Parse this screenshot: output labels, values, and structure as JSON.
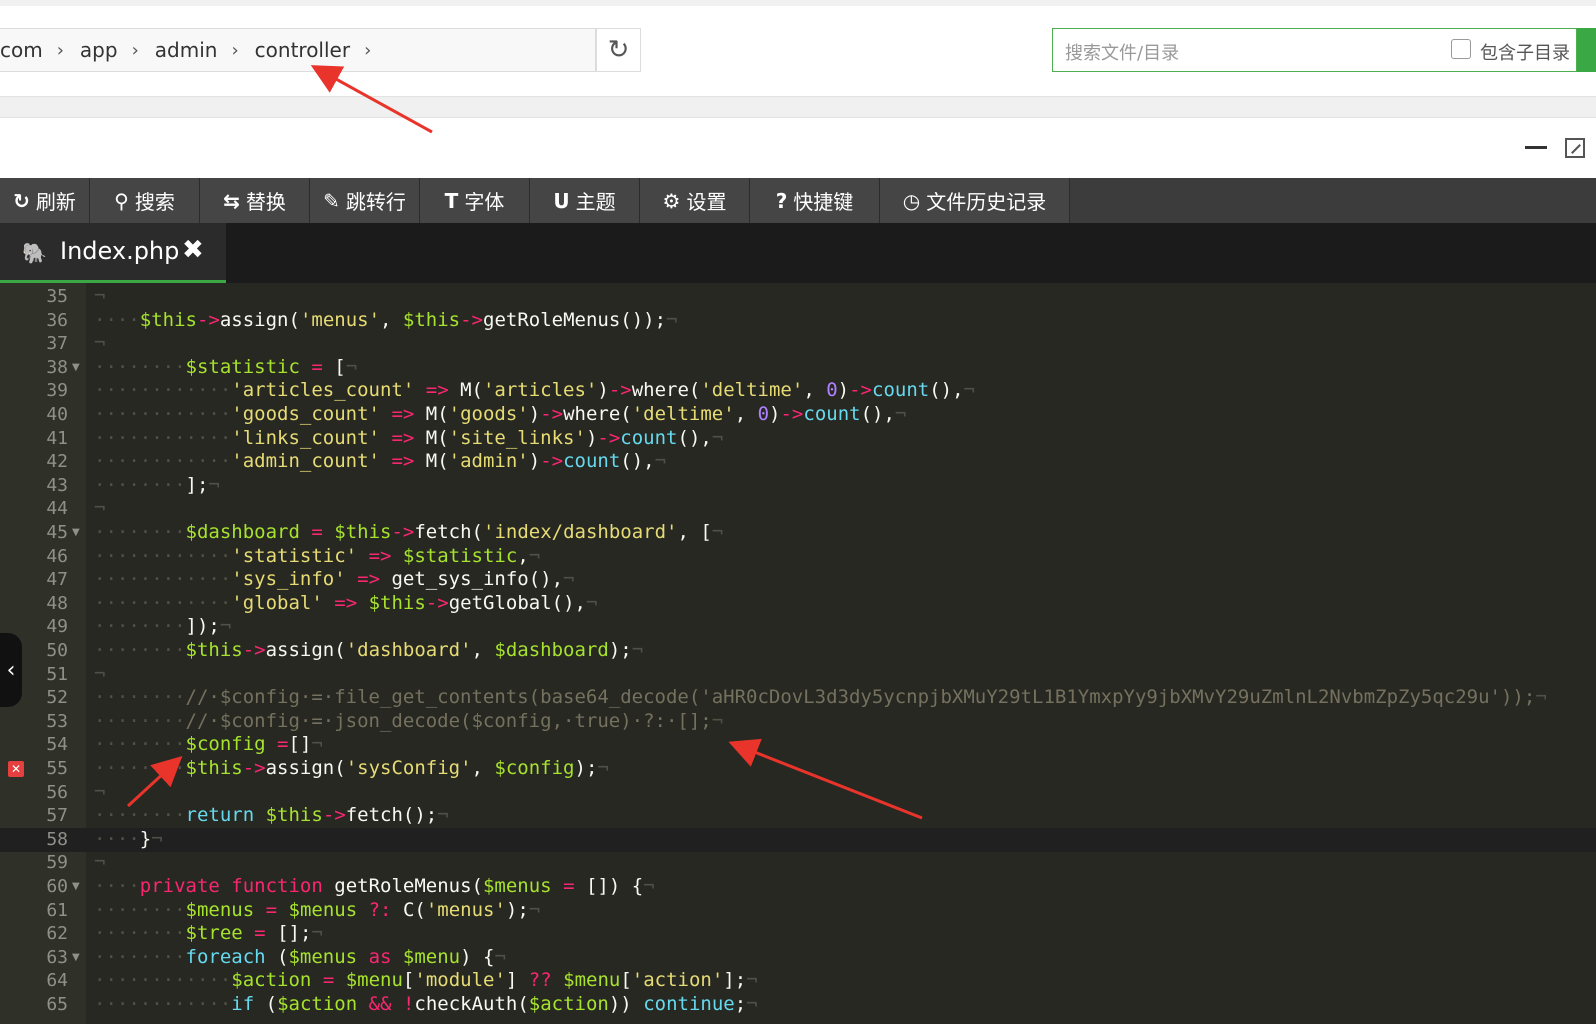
{
  "breadcrumb": {
    "segments": [
      "com",
      "app",
      "admin",
      "controller"
    ]
  },
  "search": {
    "placeholder": "搜索文件/目录",
    "include_subdir_label": "包含子目录"
  },
  "toolbar": {
    "items": [
      {
        "icon": "refresh-icon",
        "glyph": "↻",
        "label": "刷新"
      },
      {
        "icon": "search-icon",
        "glyph": "⚲",
        "label": "搜索"
      },
      {
        "icon": "replace-icon",
        "glyph": "⇆",
        "label": "替换"
      },
      {
        "icon": "pin-icon",
        "glyph": "✎",
        "label": "跳转行"
      },
      {
        "icon": "font-icon",
        "glyph": "T",
        "label": "字体"
      },
      {
        "icon": "magnet-icon",
        "glyph": "U",
        "label": "主题"
      },
      {
        "icon": "gear-icon",
        "glyph": "⚙",
        "label": "设置"
      },
      {
        "icon": "help-icon",
        "glyph": "?",
        "label": "快捷键"
      },
      {
        "icon": "clock-icon",
        "glyph": "◷",
        "label": "文件历史记录"
      }
    ]
  },
  "tab": {
    "filename": "Index.php",
    "close": "✖"
  },
  "code_lines": [
    {
      "n": "35",
      "fold": false,
      "html": "<span class=\"inv\">¬</span>"
    },
    {
      "n": "36",
      "fold": false,
      "html": "<span class=\"inv\">····</span><span class=\"vr\">$this</span><span class=\"ky\">-&gt;</span>assign(<span class=\"st\">'menus'</span>, <span class=\"vr\">$this</span><span class=\"ky\">-&gt;</span>getRoleMenus());<span class=\"inv\">¬</span>"
    },
    {
      "n": "37",
      "fold": false,
      "html": "<span class=\"inv\">¬</span>"
    },
    {
      "n": "38",
      "fold": true,
      "html": "<span class=\"inv\">········</span><span class=\"vr\">$statistic</span> <span class=\"ky\">=</span> [<span class=\"inv\">¬</span>"
    },
    {
      "n": "39",
      "fold": false,
      "html": "<span class=\"inv\">············</span><span class=\"st\">'articles_count'</span> <span class=\"ky\">=&gt;</span> M(<span class=\"st\">'articles'</span>)<span class=\"ky\">-&gt;</span>where(<span class=\"st\">'deltime'</span>, <span class=\"nm\">0</span>)<span class=\"ky\">-&gt;</span><span class=\"bl\">count</span>(),<span class=\"inv\">¬</span>"
    },
    {
      "n": "40",
      "fold": false,
      "html": "<span class=\"inv\">············</span><span class=\"st\">'goods_count'</span> <span class=\"ky\">=&gt;</span> M(<span class=\"st\">'goods'</span>)<span class=\"ky\">-&gt;</span>where(<span class=\"st\">'deltime'</span>, <span class=\"nm\">0</span>)<span class=\"ky\">-&gt;</span><span class=\"bl\">count</span>(),<span class=\"inv\">¬</span>"
    },
    {
      "n": "41",
      "fold": false,
      "html": "<span class=\"inv\">············</span><span class=\"st\">'links_count'</span> <span class=\"ky\">=&gt;</span> M(<span class=\"st\">'site_links'</span>)<span class=\"ky\">-&gt;</span><span class=\"bl\">count</span>(),<span class=\"inv\">¬</span>"
    },
    {
      "n": "42",
      "fold": false,
      "html": "<span class=\"inv\">············</span><span class=\"st\">'admin_count'</span> <span class=\"ky\">=&gt;</span> M(<span class=\"st\">'admin'</span>)<span class=\"ky\">-&gt;</span><span class=\"bl\">count</span>(),<span class=\"inv\">¬</span>"
    },
    {
      "n": "43",
      "fold": false,
      "html": "<span class=\"inv\">········</span>];<span class=\"inv\">¬</span>"
    },
    {
      "n": "44",
      "fold": false,
      "html": "<span class=\"inv\">¬</span>"
    },
    {
      "n": "45",
      "fold": true,
      "html": "<span class=\"inv\">········</span><span class=\"vr\">$dashboard</span> <span class=\"ky\">=</span> <span class=\"vr\">$this</span><span class=\"ky\">-&gt;</span>fetch(<span class=\"st\">'index/dashboard'</span>, [<span class=\"inv\">¬</span>"
    },
    {
      "n": "46",
      "fold": false,
      "html": "<span class=\"inv\">············</span><span class=\"st\">'statistic'</span> <span class=\"ky\">=&gt;</span> <span class=\"vr\">$statistic</span>,<span class=\"inv\">¬</span>"
    },
    {
      "n": "47",
      "fold": false,
      "html": "<span class=\"inv\">············</span><span class=\"st\">'sys_info'</span> <span class=\"ky\">=&gt;</span> get_sys_info(),<span class=\"inv\">¬</span>"
    },
    {
      "n": "48",
      "fold": false,
      "html": "<span class=\"inv\">············</span><span class=\"st\">'global'</span> <span class=\"ky\">=&gt;</span> <span class=\"vr\">$this</span><span class=\"ky\">-&gt;</span>getGlobal(),<span class=\"inv\">¬</span>"
    },
    {
      "n": "49",
      "fold": false,
      "html": "<span class=\"inv\">········</span>]);<span class=\"inv\">¬</span>"
    },
    {
      "n": "50",
      "fold": false,
      "html": "<span class=\"inv\">········</span><span class=\"vr\">$this</span><span class=\"ky\">-&gt;</span>assign(<span class=\"st\">'dashboard'</span>, <span class=\"vr\">$dashboard</span>);<span class=\"inv\">¬</span>"
    },
    {
      "n": "51",
      "fold": false,
      "html": "<span class=\"inv\">¬</span>"
    },
    {
      "n": "52",
      "fold": false,
      "html": "<span class=\"inv\">········</span><span class=\"cm\">//·$config·=·file_get_contents(base64_decode('aHR0cDovL3d3dy5ycnpjbXMuY29tL1B1YmxpYy9jbXMvY29uZmlnL2NvbmZpZy5qc29u'));</span><span class=\"inv\">¬</span>"
    },
    {
      "n": "53",
      "fold": false,
      "html": "<span class=\"inv\">········</span><span class=\"cm\">//·$config·=·json_decode($config,·true)·?:·[];</span><span class=\"inv\">¬</span>"
    },
    {
      "n": "54",
      "fold": false,
      "html": "<span class=\"inv\">········</span><span class=\"vr\">$config</span> <span class=\"ky\">=</span>[]<span class=\"inv\">¬</span>"
    },
    {
      "n": "55",
      "fold": false,
      "html": "<span class=\"inv\">········</span><span class=\"vr\">$this</span><span class=\"ky\">-&gt;</span>assign(<span class=\"st\">'sysConfig'</span>, <span class=\"vr\">$config</span>);<span class=\"inv\">¬</span>"
    },
    {
      "n": "56",
      "fold": false,
      "html": "<span class=\"inv\">¬</span>"
    },
    {
      "n": "57",
      "fold": false,
      "html": "<span class=\"inv\">········</span><span class=\"bl\">return</span> <span class=\"vr\">$this</span><span class=\"ky\">-&gt;</span>fetch();<span class=\"inv\">¬</span>"
    },
    {
      "n": "58",
      "fold": false,
      "html": "<span class=\"inv\">····</span>}<span class=\"inv\">¬</span>"
    },
    {
      "n": "59",
      "fold": false,
      "html": "<span class=\"inv\">¬</span>"
    },
    {
      "n": "60",
      "fold": true,
      "html": "<span class=\"inv\">····</span><span class=\"ky\">private</span> <span class=\"ky\">function</span> getRoleMenus(<span class=\"vr\">$menus</span> <span class=\"ky\">=</span> []) {<span class=\"inv\">¬</span>"
    },
    {
      "n": "61",
      "fold": false,
      "html": "<span class=\"inv\">········</span><span class=\"vr\">$menus</span> <span class=\"ky\">=</span> <span class=\"vr\">$menus</span> <span class=\"ky\">?:</span> C(<span class=\"st\">'menus'</span>);<span class=\"inv\">¬</span>"
    },
    {
      "n": "62",
      "fold": false,
      "html": "<span class=\"inv\">········</span><span class=\"vr\">$tree</span> <span class=\"ky\">=</span> [];<span class=\"inv\">¬</span>"
    },
    {
      "n": "63",
      "fold": true,
      "html": "<span class=\"inv\">········</span><span class=\"bl\">foreach</span> (<span class=\"vr\">$menus</span> <span class=\"ky\">as</span> <span class=\"vr\">$menu</span>) {<span class=\"inv\">¬</span>"
    },
    {
      "n": "64",
      "fold": false,
      "html": "<span class=\"inv\">············</span><span class=\"vr\">$action</span> <span class=\"ky\">=</span> <span class=\"vr\">$menu</span>[<span class=\"st\">'module'</span>] <span class=\"ky\">??</span> <span class=\"vr\">$menu</span>[<span class=\"st\">'action'</span>];<span class=\"inv\">¬</span>"
    },
    {
      "n": "65",
      "fold": false,
      "html": "<span class=\"inv\">············</span><span class=\"bl\">if</span> (<span class=\"vr\">$action</span> <span class=\"ky\">&amp;&amp;</span> <span class=\"ky\">!</span>checkAuth(<span class=\"vr\">$action</span>)) <span class=\"bl\">continue</span>;<span class=\"inv\">¬</span>"
    }
  ],
  "error_line": "55",
  "active_line": "58",
  "colors": {
    "editor_bg": "#272822",
    "accent_green": "#3aa845",
    "arrow_red": "#e8342b"
  }
}
